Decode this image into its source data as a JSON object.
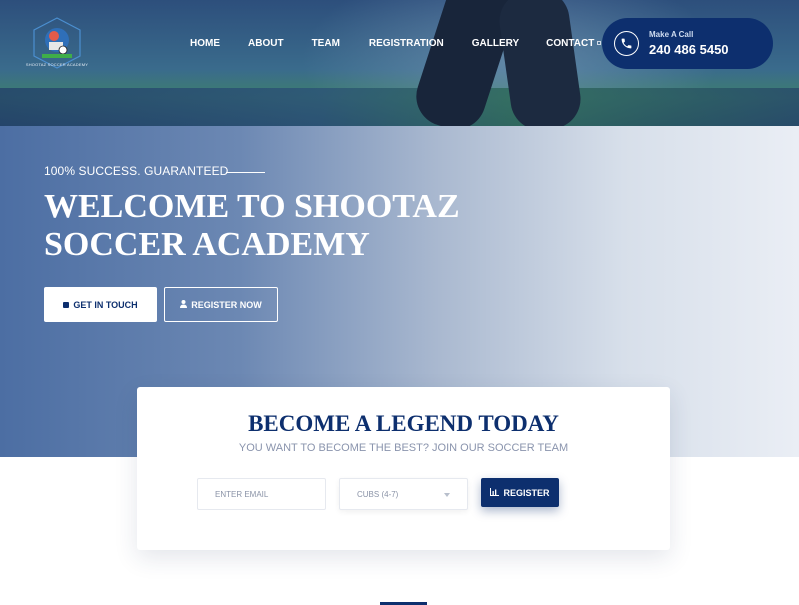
{
  "logo": {
    "alt_text": "SHOOTAZ SOCCER ACADEMY"
  },
  "nav": {
    "items": [
      {
        "label": "HOME"
      },
      {
        "label": "ABOUT"
      },
      {
        "label": "TEAM"
      },
      {
        "label": "REGISTRATION"
      },
      {
        "label": "GALLERY"
      },
      {
        "label": "CONTACT"
      }
    ]
  },
  "call": {
    "label": "Make A Call",
    "number": "240 486 5450",
    "icon": "phone-icon"
  },
  "hero": {
    "tagline": "100% SUCCESS. GUARANTEED",
    "title": "WELCOME TO SHOOTAZ SOCCER ACADEMY",
    "buttons": {
      "get_in_touch": "GET IN TOUCH",
      "register_now": "REGISTER NOW"
    }
  },
  "signup": {
    "title": "BECOME A LEGEND TODAY",
    "subtitle": "YOU WANT TO BECOME THE BEST? JOIN OUR SOCCER TEAM",
    "email_placeholder": "ENTER EMAIL",
    "email_value": "",
    "group_selected": "CUBS (4-7)",
    "register_label": "REGISTER"
  },
  "colors": {
    "brand_navy": "#0d2f6e",
    "hero_start": "#4c6ea3",
    "hero_end": "#eaeef5"
  }
}
